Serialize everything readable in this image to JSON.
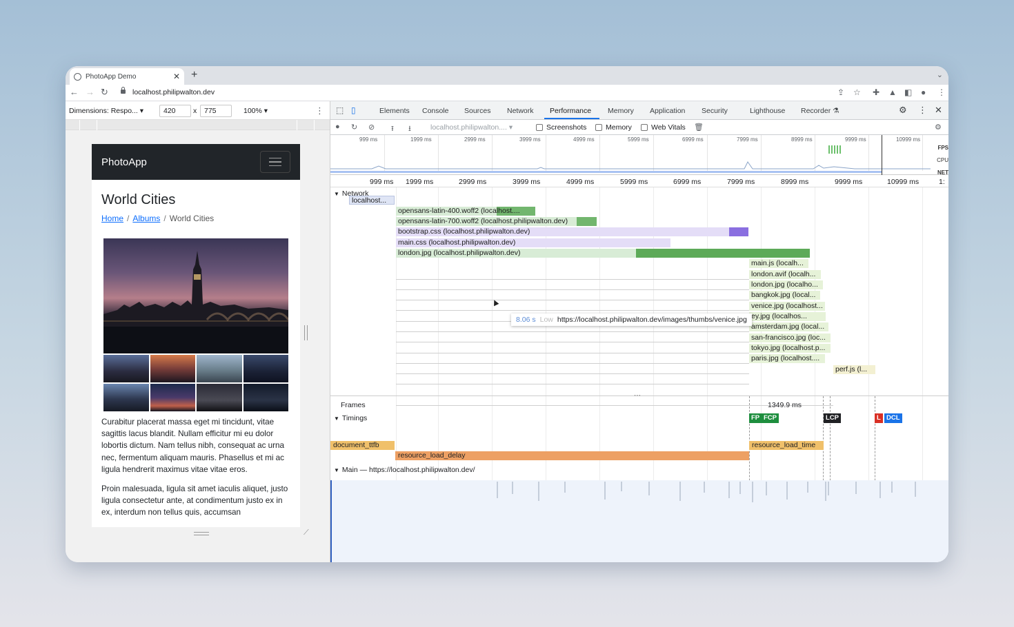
{
  "browser": {
    "tab_title": "PhotoApp Demo",
    "url": "localhost.philipwalton.dev"
  },
  "device": {
    "dimensions_label": "Dimensions: Respo...",
    "width": "420",
    "times": "x",
    "height": "775",
    "zoom": "100%"
  },
  "page": {
    "brand": "PhotoApp",
    "title": "World Cities",
    "crumb_home": "Home",
    "crumb_albums": "Albums",
    "crumb_current": "World Cities",
    "para1": "Curabitur placerat massa eget mi tincidunt, vitae sagittis lacus blandit. Nullam efficitur mi eu dolor lobortis dictum. Nam tellus nibh, consequat ac urna nec, fermentum aliquam mauris. Phasellus et mi ac ligula hendrerit maximus vitae vitae eros.",
    "para2": "Proin malesuada, ligula sit amet iaculis aliquet, justo ligula consectetur ante, at condimentum justo ex in ex, interdum non tellus quis, accumsan"
  },
  "devtools": {
    "tabs": [
      "Elements",
      "Console",
      "Sources",
      "Network",
      "Performance",
      "Memory",
      "Application",
      "Security",
      "Lighthouse",
      "Recorder"
    ],
    "active_tab": "Performance",
    "profile_select": "localhost.philipwalton....",
    "checkbox_screenshots": "Screenshots",
    "checkbox_memory": "Memory",
    "checkbox_webvitals": "Web Vitals",
    "overview_ticks": [
      "999 ms",
      "1999 ms",
      "2999 ms",
      "3999 ms",
      "4999 ms",
      "5999 ms",
      "6999 ms",
      "7999 ms",
      "8999 ms",
      "9999 ms",
      "10999 ms"
    ],
    "overview_side": [
      "FPS",
      "CPU",
      "NET"
    ],
    "ruler_ticks": [
      "999 ms",
      "1999 ms",
      "2999 ms",
      "3999 ms",
      "4999 ms",
      "5999 ms",
      "6999 ms",
      "7999 ms",
      "8999 ms",
      "9999 ms",
      "10999 ms",
      "1:"
    ],
    "network_label": "Network",
    "requests": [
      "localhost...",
      "opensans-latin-400.woff2 (localhost....",
      "opensans-latin-700.woff2 (localhost.philipwalton.dev)",
      "bootstrap.css (localhost.philipwalton.dev)",
      "main.css (localhost.philipwalton.dev)",
      "london.jpg (localhost.philipwalton.dev)",
      "main.js (localh...",
      "london.avif (localh...",
      "london.jpg (localho...",
      "bangkok.jpg (local...",
      "venice.jpg (localhost...",
      "ey.jpg (localhos...",
      "amsterdam.jpg (local...",
      "san-francisco.jpg (loc...",
      "tokyo.jpg (localhost.p...",
      "paris.jpg (localhost....",
      "perf.js (l..."
    ],
    "tooltip_time": "8.06 s",
    "tooltip_priority": "Low",
    "tooltip_url": "https://localhost.philipwalton.dev/images/thumbs/venice.jpg",
    "frames_label": "Frames",
    "frame_time": "1349.9 ms",
    "timings_label": "Timings",
    "markers": [
      "FP",
      "FCP",
      "LCP",
      "L",
      "DCL"
    ],
    "marker_colors": {
      "FP": "#1e8e3e",
      "FCP": "#1e8e3e",
      "LCP": "#202124",
      "L": "#d93025",
      "DCL": "#1a73e8"
    },
    "timing_bars": [
      "document_ttfb",
      "resource_load_delay",
      "resource_load_time"
    ],
    "main_label": "Main — https://localhost.philipwalton.dev/"
  }
}
